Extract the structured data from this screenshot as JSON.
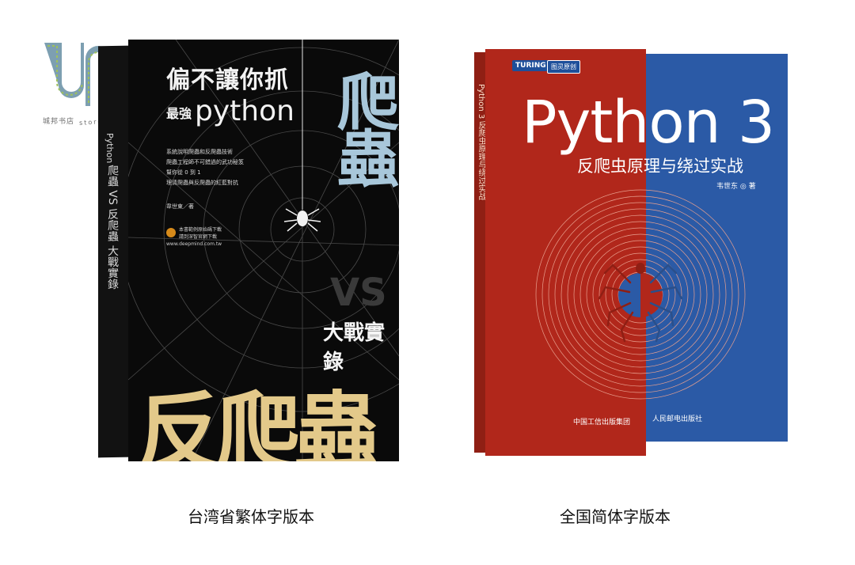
{
  "logo": {
    "text": "UN book store",
    "sub_cn": "城邦书店",
    "sub_en": "store",
    "colors": {
      "mark": "#7d9fb1",
      "accent": "#9fc15b"
    }
  },
  "book_traditional": {
    "top_title": "偏不讓你抓",
    "py_prefix": "最強",
    "py_word": "python",
    "bullets": [
      "系統說明爬蟲和反爬蟲技術",
      "爬蟲工程師不可錯過的武功秘笈",
      "幫你從 0 到 1",
      "理清爬蟲與反爬蟲的紅藍對抗"
    ],
    "author": "韋世東／著",
    "qr_lines": [
      "本書範例原始碼下載",
      "請到深智官網下載",
      "www.deepmind.com.tw"
    ],
    "big_crawl": "爬蟲",
    "vs": "VS",
    "war": "大戰實錄",
    "anti": "反爬蟲",
    "spine_py": "Python",
    "spine_text": "爬蟲 VS 反爬蟲 大戰實錄"
  },
  "book_simplified": {
    "publisher_badge": "TURING",
    "publisher_badge2": "图灵原创",
    "title": "Python 3",
    "subtitle": "反爬虫原理与绕过实战",
    "author": "韦世东 ◎ 著",
    "publisher1": "中国工信出版集团",
    "publisher2": "人民邮电出版社",
    "spine_text": "Python 3 反爬虫原理与绕过实战",
    "colors": {
      "red": "#b1271b",
      "blue": "#2b5aa6"
    }
  },
  "captions": {
    "left": "台湾省繁体字版本",
    "right": "全国简体字版本"
  }
}
